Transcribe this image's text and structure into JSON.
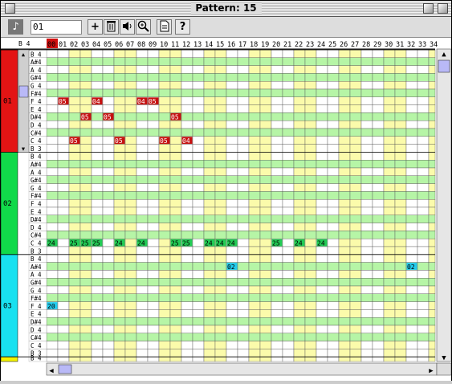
{
  "window": {
    "title": "Pattern: 15"
  },
  "toolbar": {
    "pattern_value": "01",
    "icons": [
      "note-icon",
      "add-icon",
      "trash-icon",
      "speaker-icon",
      "zoom-icon",
      "document-icon",
      "help-icon"
    ],
    "help_label": "?"
  },
  "header_note": "B 4",
  "steps": [
    "00",
    "01",
    "02",
    "03",
    "04",
    "05",
    "06",
    "07",
    "08",
    "09",
    "10",
    "11",
    "12",
    "13",
    "14",
    "15",
    "16",
    "17",
    "18",
    "19",
    "20",
    "21",
    "22",
    "23",
    "24",
    "25",
    "26",
    "27",
    "28",
    "29",
    "30",
    "31",
    "32",
    "33",
    "34"
  ],
  "notes": [
    "B 4",
    "A#4",
    "A 4",
    "G#4",
    "G 4",
    "F#4",
    "F 4",
    "E 4",
    "D#4",
    "D 4",
    "C#4",
    "C 4",
    "B 3"
  ],
  "tracks": [
    {
      "label": "01",
      "color": "#e31414",
      "cell_color": "#c61010",
      "text_color": "#ffffff",
      "events": [
        {
          "n": 6,
          "s": 1,
          "v": "05"
        },
        {
          "n": 6,
          "s": 4,
          "v": "04"
        },
        {
          "n": 6,
          "s": 8,
          "v": "04"
        },
        {
          "n": 6,
          "s": 9,
          "v": "05"
        },
        {
          "n": 8,
          "s": 3,
          "v": "05"
        },
        {
          "n": 8,
          "s": 5,
          "v": "05"
        },
        {
          "n": 8,
          "s": 11,
          "v": "05"
        },
        {
          "n": 11,
          "s": 2,
          "v": "05"
        },
        {
          "n": 11,
          "s": 6,
          "v": "05"
        },
        {
          "n": 11,
          "s": 10,
          "v": "05"
        },
        {
          "n": 11,
          "s": 12,
          "v": "04"
        }
      ]
    },
    {
      "label": "02",
      "color": "#11d94a",
      "cell_color": "#22cc55",
      "text_color": "#000000",
      "events": [
        {
          "n": 11,
          "s": 0,
          "v": "24"
        },
        {
          "n": 11,
          "s": 2,
          "v": "25"
        },
        {
          "n": 11,
          "s": 3,
          "v": "25"
        },
        {
          "n": 11,
          "s": 4,
          "v": "25"
        },
        {
          "n": 11,
          "s": 6,
          "v": "24"
        },
        {
          "n": 11,
          "s": 8,
          "v": "24"
        },
        {
          "n": 11,
          "s": 11,
          "v": "25"
        },
        {
          "n": 11,
          "s": 12,
          "v": "25"
        },
        {
          "n": 11,
          "s": 14,
          "v": "24"
        },
        {
          "n": 11,
          "s": 15,
          "v": "24"
        },
        {
          "n": 11,
          "s": 16,
          "v": "24"
        },
        {
          "n": 11,
          "s": 20,
          "v": "25"
        },
        {
          "n": 11,
          "s": 22,
          "v": "24"
        },
        {
          "n": 11,
          "s": 24,
          "v": "24"
        }
      ]
    },
    {
      "label": "03",
      "color": "#19e1f0",
      "cell_color": "#22ccee",
      "text_color": "#000000",
      "events": [
        {
          "n": 1,
          "s": 16,
          "v": "02"
        },
        {
          "n": 1,
          "s": 32,
          "v": "02"
        },
        {
          "n": 6,
          "s": 0,
          "v": "20"
        }
      ]
    },
    {
      "label": "",
      "color": "#f3f300",
      "cell_color": "#f3f300",
      "text_color": "#000000",
      "events": []
    }
  ],
  "row_colors": {
    "sharp": "#b6f5a6",
    "natural": "#ffffff",
    "beat": "#fbfbab",
    "grid": "#555555",
    "red_header": "#d01010"
  }
}
